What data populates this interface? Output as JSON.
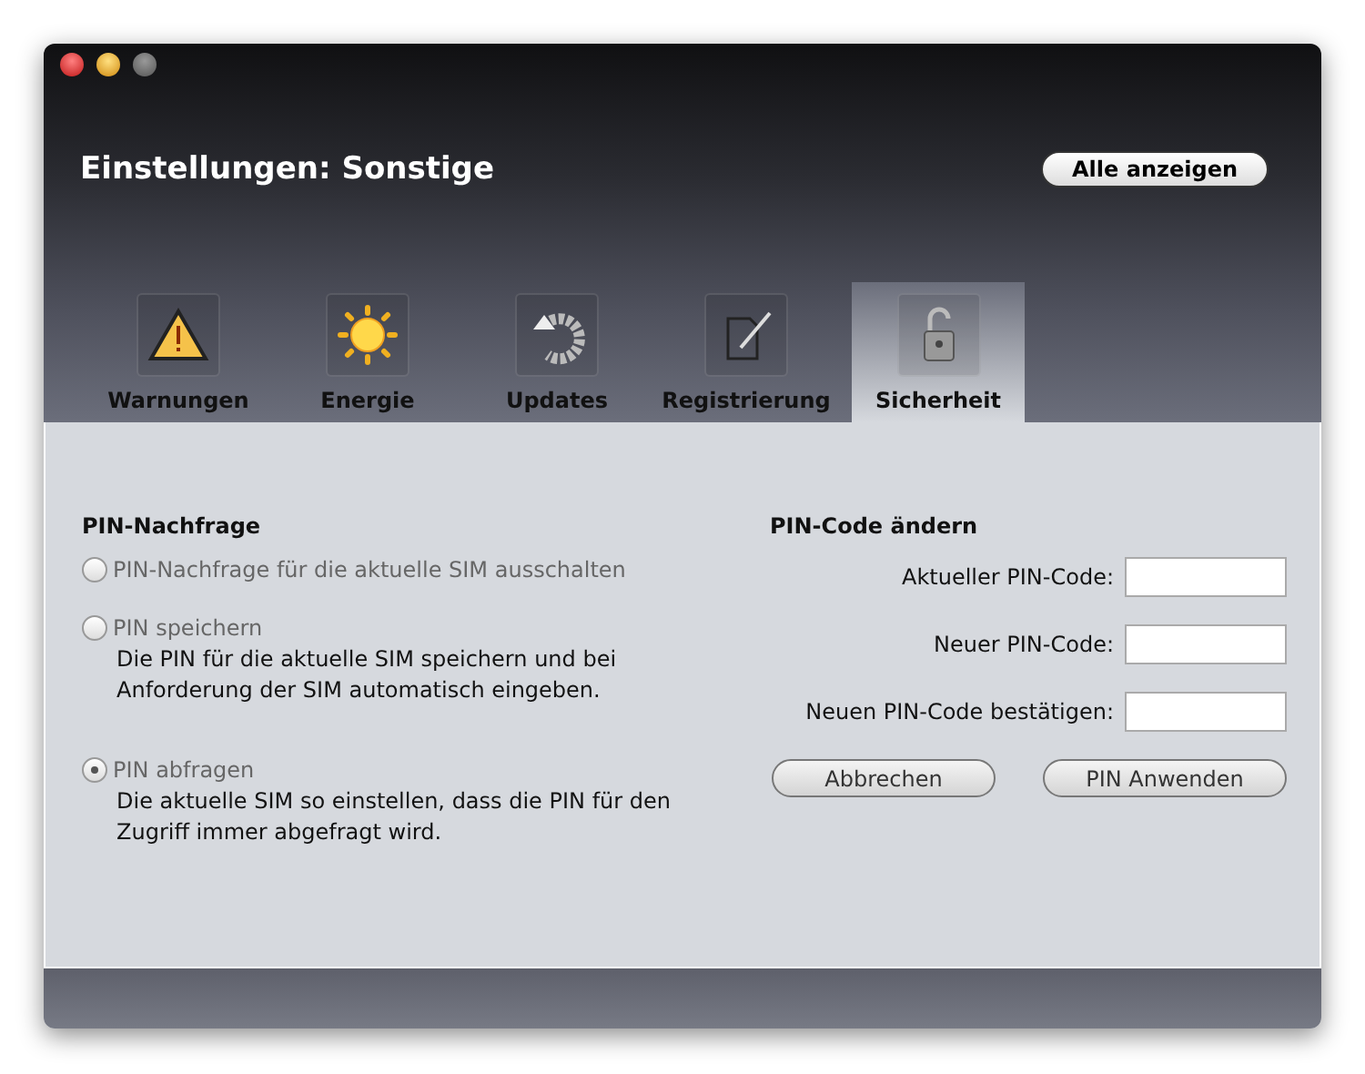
{
  "window": {
    "title": "Einstellungen: Sonstige",
    "show_all_button": "Alle anzeigen"
  },
  "tabs": [
    {
      "label": "Warnungen",
      "kind": "warning",
      "selected": false
    },
    {
      "label": "Energie",
      "kind": "sun",
      "selected": false
    },
    {
      "label": "Updates",
      "kind": "update",
      "selected": false
    },
    {
      "label": "Registrierung",
      "kind": "document",
      "selected": false
    },
    {
      "label": "Sicherheit",
      "kind": "lock",
      "selected": true
    }
  ],
  "pin_request": {
    "heading": "PIN-Nachfrage",
    "options": [
      {
        "label": "PIN-Nachfrage für die aktuelle SIM ausschalten",
        "selected": false
      },
      {
        "label": "PIN speichern",
        "description": "Die PIN für die aktuelle SIM speichern und bei Anforderung der SIM automatisch eingeben.",
        "selected": false
      },
      {
        "label": "PIN abfragen",
        "description": "Die aktuelle SIM so einstellen, dass die PIN für den Zugriff immer abgefragt wird.",
        "selected": true
      }
    ]
  },
  "change_pin": {
    "heading": "PIN-Code ändern",
    "fields": [
      {
        "label": "Aktueller PIN-Code:"
      },
      {
        "label": "Neuer PIN-Code:"
      },
      {
        "label": "Neuen PIN-Code bestätigen:"
      }
    ],
    "buttons": [
      "Abbrechen",
      "PIN Anwenden"
    ]
  }
}
